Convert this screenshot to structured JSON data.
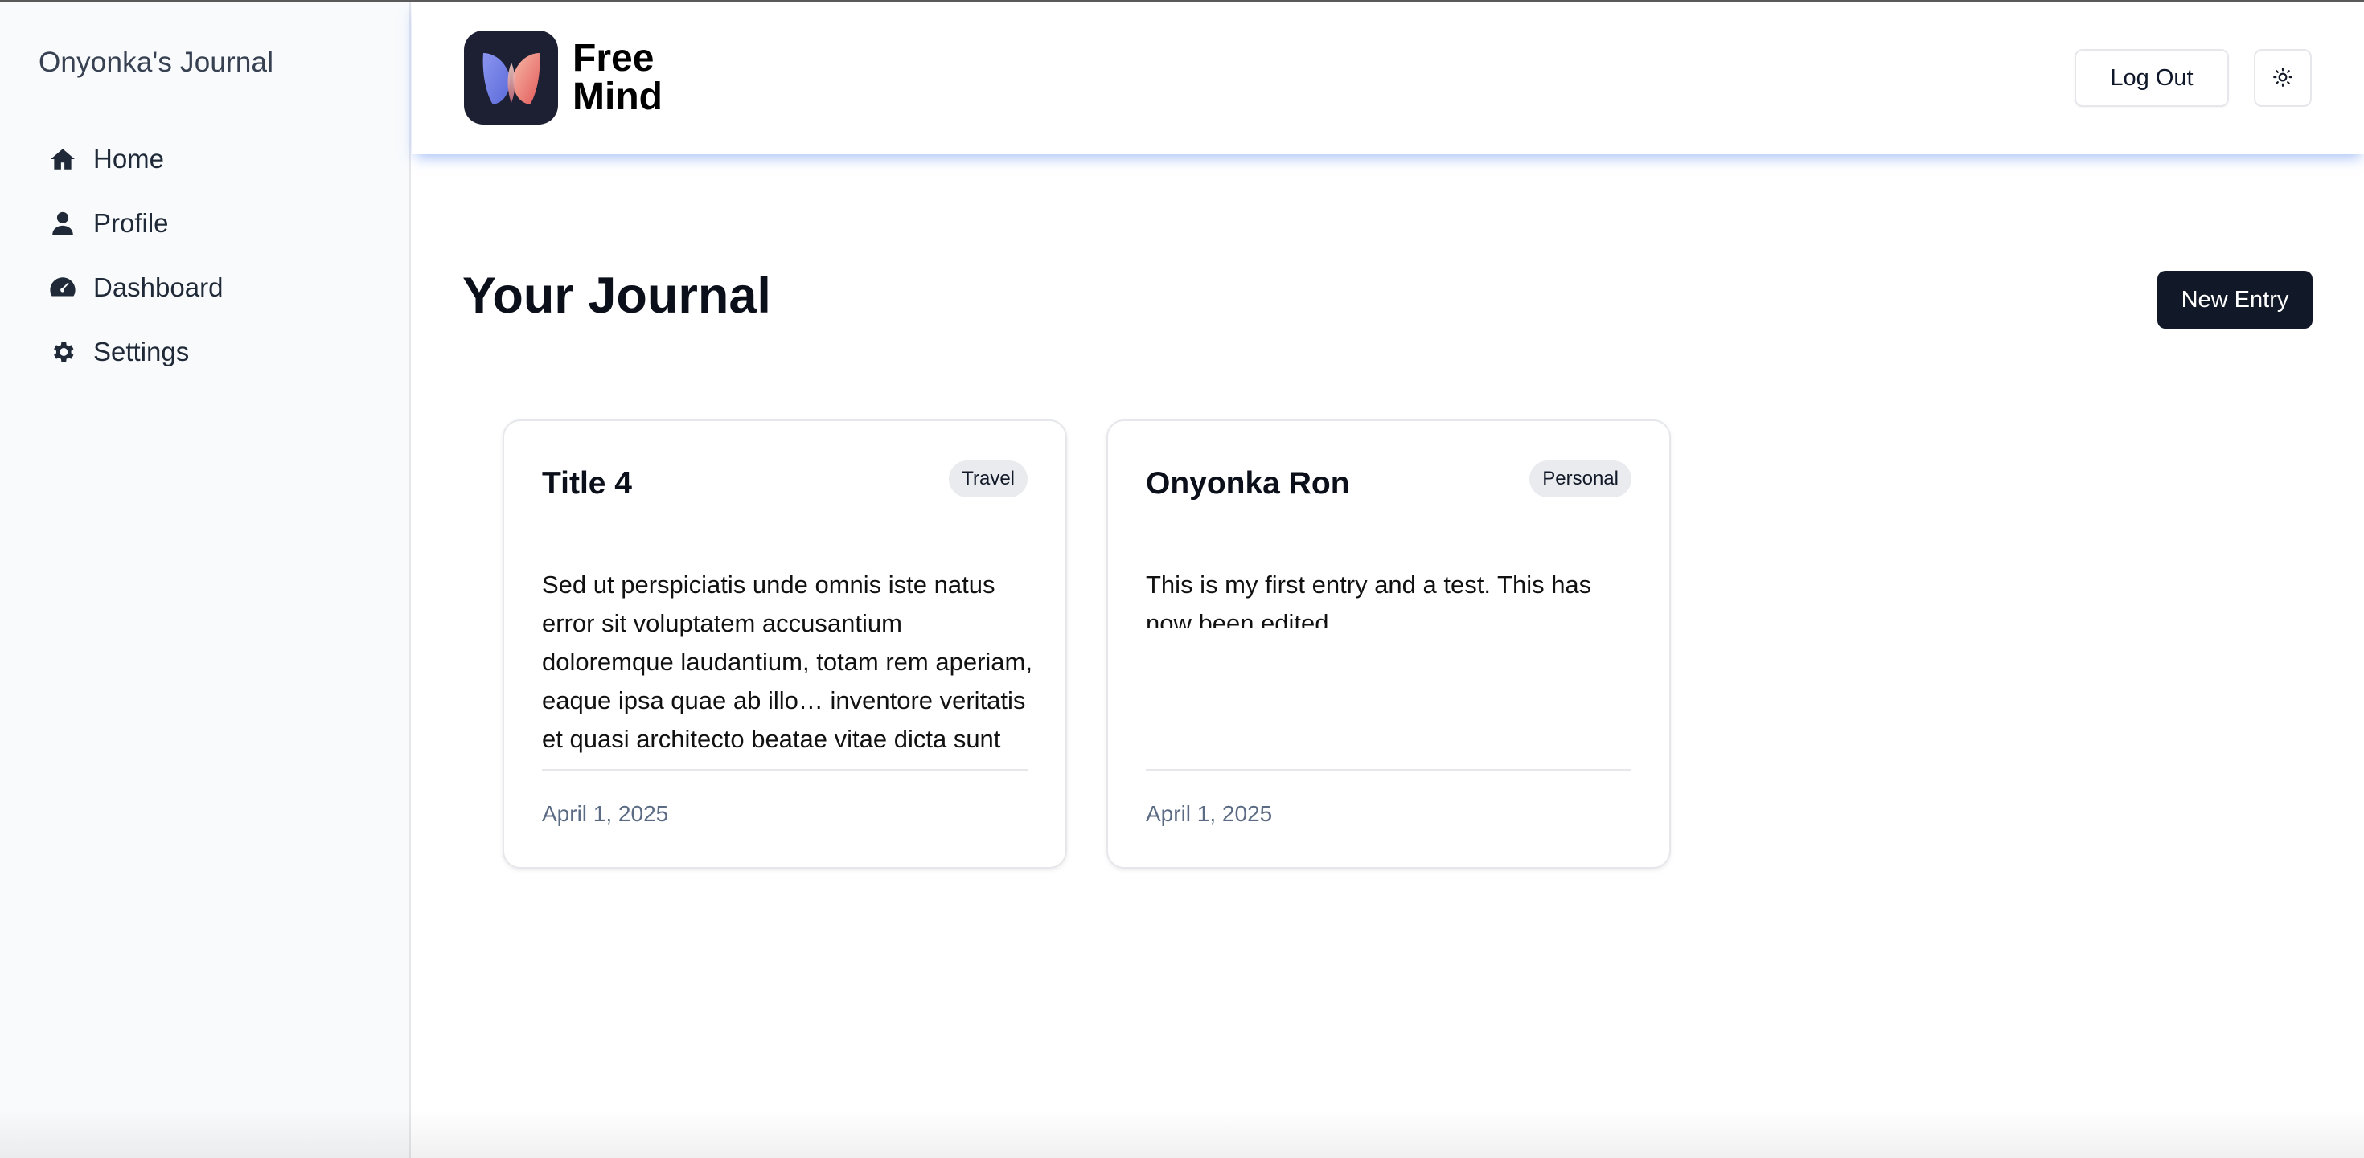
{
  "sidebar": {
    "title": "Onyonka's Journal",
    "items": [
      {
        "label": "Home",
        "icon": "home-icon"
      },
      {
        "label": "Profile",
        "icon": "user-icon"
      },
      {
        "label": "Dashboard",
        "icon": "gauge-icon"
      },
      {
        "label": "Settings",
        "icon": "gear-icon"
      }
    ]
  },
  "header": {
    "logo_line1": "Free",
    "logo_line2": "Mind",
    "logout_label": "Log Out",
    "theme_icon": "sun-icon"
  },
  "main": {
    "title": "Your Journal",
    "new_entry_label": "New Entry",
    "entries": [
      {
        "title": "Title 4",
        "tag": "Travel",
        "body": "Sed ut perspiciatis unde omnis iste natus error sit voluptatem accusantium doloremque laudantium, totam rem aperiam, eaque ipsa quae ab illo… inventore veritatis et quasi architecto beatae vitae dicta sunt explicabo. Nemo",
        "date": "April 1, 2025"
      },
      {
        "title": "Onyonka Ron",
        "tag": "Personal",
        "body": "This is my first entry and a test. This has now been edited",
        "date": "April 1, 2025"
      }
    ]
  },
  "colors": {
    "primary_button": "#111827",
    "sidebar_bg": "#f8fafc",
    "header_shadow": "#608cf0",
    "date_text": "#5b6b84"
  }
}
